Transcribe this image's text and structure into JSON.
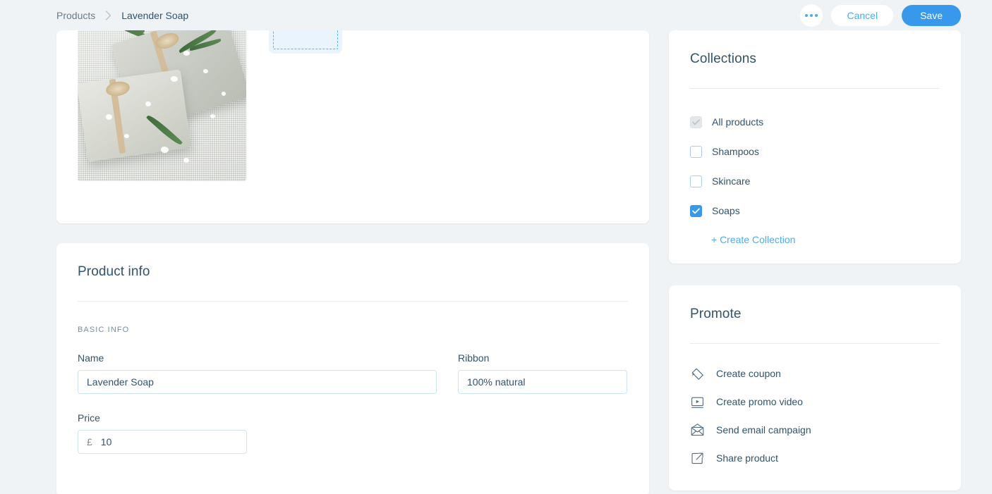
{
  "breadcrumb": {
    "parent": "Products",
    "separator_icon": "chevron-right-icon",
    "current": "Lavender Soap"
  },
  "top_actions": {
    "more_icon": "ellipsis-icon",
    "cancel_label": "Cancel",
    "save_label": "Save"
  },
  "media": {
    "product_image_alt": "Lavender soap bars with rosemary sprigs on woven fabric",
    "add_image_icon": "plus-icon"
  },
  "product_info": {
    "title": "Product info",
    "section_label": "BASIC INFO",
    "name": {
      "label": "Name",
      "value": "Lavender Soap"
    },
    "ribbon": {
      "label": "Ribbon",
      "value": "100% natural"
    },
    "price": {
      "label": "Price",
      "currency_symbol": "£",
      "value": "10"
    }
  },
  "collections": {
    "title": "Collections",
    "items": [
      {
        "label": "All products",
        "state": "disabled-checked"
      },
      {
        "label": "Shampoos",
        "state": "unchecked"
      },
      {
        "label": "Skincare",
        "state": "unchecked"
      },
      {
        "label": "Soaps",
        "state": "checked"
      }
    ],
    "create_link": "+ Create Collection"
  },
  "promote": {
    "title": "Promote",
    "items": [
      {
        "label": "Create coupon",
        "icon": "coupon-tag-icon"
      },
      {
        "label": "Create promo video",
        "icon": "video-play-icon"
      },
      {
        "label": "Send email campaign",
        "icon": "envelope-icon"
      },
      {
        "label": "Share product",
        "icon": "share-external-icon"
      }
    ]
  },
  "colors": {
    "background": "#f0f3f5",
    "card": "#ffffff",
    "accent_blue": "#3899ec",
    "link_blue": "#4eabf1",
    "text_dark": "#32536a",
    "text_muted": "#7a8c99",
    "input_border": "#cfe5f6",
    "add_tile_bg": "#e9f4fd"
  }
}
